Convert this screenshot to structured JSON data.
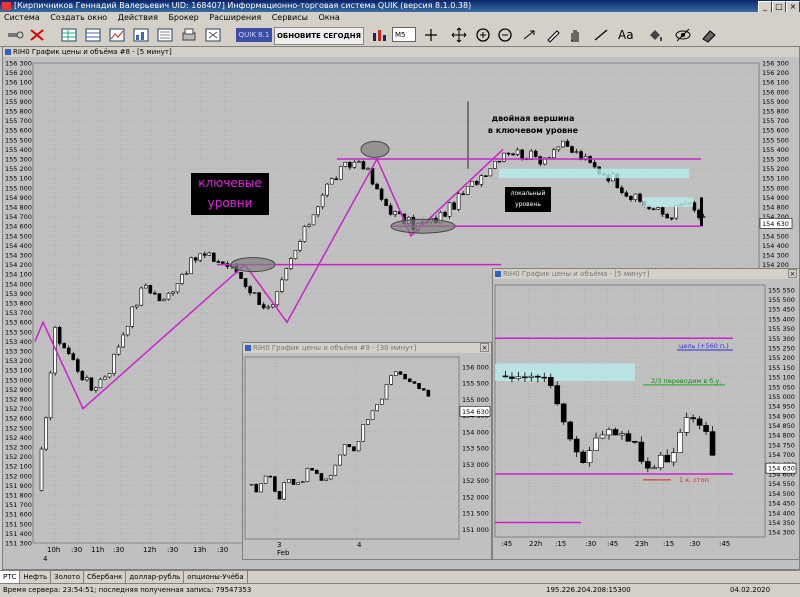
{
  "app": {
    "title": "[Кирпичников Геннадий Валерьевич UID: 168407] Информационно-торговая система QUIK (версия 8.1.0.38)"
  },
  "menu": [
    "Система",
    "Создать окно",
    "Действия",
    "Брокер",
    "Расширения",
    "Сервисы",
    "Окна"
  ],
  "toolbar": {
    "quik_label": "QUIK 8.1",
    "refresh_label": "ОБНОВИТЕ СЕГОДНЯ",
    "timeframe": "M5",
    "text_tool": "Aa"
  },
  "windows": {
    "main": {
      "title": "RIH0 График цены и объёма #8 - [5 минут]",
      "y_ticks": [
        "156 300",
        "156 200",
        "156 100",
        "156 000",
        "155 900",
        "155 800",
        "155 700",
        "155 600",
        "155 500",
        "155 400",
        "155 300",
        "155 200",
        "155 100",
        "155 000",
        "154 900",
        "154 800",
        "154 700",
        "154 600",
        "154 500",
        "154 400",
        "154 300",
        "154 200",
        "154 100",
        "154 000",
        "153 900",
        "153 800",
        "153 700",
        "153 600",
        "153 500",
        "153 400",
        "153 300",
        "153 200",
        "153 100",
        "153 000",
        "152 900",
        "152 800",
        "152 700",
        "152 600",
        "152 500",
        "152 400",
        "152 300",
        "152 200",
        "152 100",
        "152 000",
        "151 900",
        "151 800",
        "151 700",
        "151 600",
        "151 500",
        "151 400",
        "151 300"
      ],
      "right_ticks": [
        "156 300",
        "156 200",
        "156 100",
        "156 000",
        "155 900",
        "155 800",
        "155 700",
        "155 600",
        "155 500",
        "155 400",
        "155 300",
        "155 200",
        "155 100",
        "155 000",
        "154 900",
        "154 800",
        "154 700",
        "154 600",
        "154 500",
        "154 400",
        "154 300",
        "154 200"
      ],
      "x_ticks": [
        "10h",
        ":30",
        "11h",
        ":30",
        "12h",
        ":30",
        "13h",
        ":30"
      ],
      "date_label": "4",
      "last_price": "154 630",
      "annotations": {
        "key_levels": [
          "ключевые",
          "уровни"
        ],
        "double_top": [
          "двойная вершина",
          "в ключевом уровне"
        ],
        "local_level": [
          "локальный",
          "уровень"
        ]
      }
    },
    "w30": {
      "title": "RIH0 График цены и объёма #9 - [30 минут]",
      "y_ticks": [
        "156 000",
        "155 500",
        "155 000",
        "154 500",
        "154 000",
        "153 500",
        "153 000",
        "152 500",
        "152 000",
        "151 500",
        "151 000"
      ],
      "x_ticks": [
        "3",
        "4"
      ],
      "month_label": "Feb",
      "last_price": "154 630"
    },
    "w5": {
      "title": "RIH0 График цены и объёма - [5 минут]",
      "y_ticks": [
        "155 550",
        "155 500",
        "155 450",
        "155 400",
        "155 350",
        "155 300",
        "155 250",
        "155 200",
        "155 150",
        "155 100",
        "155 050",
        "155 000",
        "154 950",
        "154 900",
        "154 850",
        "154 800",
        "154 750",
        "154 700",
        "154 650",
        "154 600",
        "154 550",
        "154 500",
        "154 450",
        "154 400",
        "154 350",
        "154 300"
      ],
      "x_ticks": [
        ":45",
        "22h",
        ":15",
        ":30",
        ":45",
        "23h",
        ":15",
        ":30",
        ":45"
      ],
      "last_price": "154 630",
      "annotations": {
        "target": "цель (+560 п.)",
        "breakeven": "2/3 переводим в б.у.",
        "stop": "1 к. стоп"
      }
    }
  },
  "tabs": [
    {
      "label": "РТС",
      "active": true
    },
    {
      "label": "Нефть",
      "active": false
    },
    {
      "label": "Золото",
      "active": false
    },
    {
      "label": "Сбербанк",
      "active": false
    },
    {
      "label": "доллар-рубль",
      "active": false
    },
    {
      "label": "опционы-Учёба",
      "active": false
    }
  ],
  "status": {
    "server_time": "Время сервера: 23:54:51; последняя полученная запись: 79547353",
    "ip": "195.226.204.208:15300",
    "date": "04.02.2020"
  },
  "colors": {
    "bull": "#ffffff",
    "bear": "#000000",
    "level_line": "#cc22cc",
    "zone": "#b8ecec",
    "stop": "#dd2222",
    "target": "#3030cc"
  }
}
